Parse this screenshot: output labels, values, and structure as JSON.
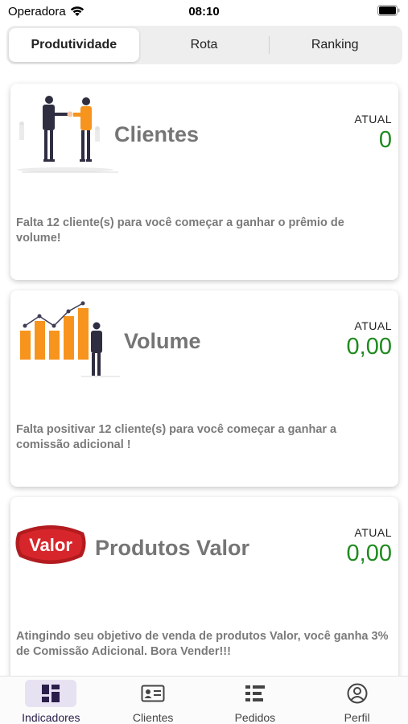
{
  "status_bar": {
    "carrier": "Operadora",
    "time": "08:10"
  },
  "segments": {
    "items": [
      {
        "label": "Produtividade",
        "selected": true
      },
      {
        "label": "Rota",
        "selected": false
      },
      {
        "label": "Ranking",
        "selected": false
      }
    ]
  },
  "cards": [
    {
      "title": "Clientes",
      "atual_label": "ATUAL",
      "atual_value": "0",
      "description": "Falta 12 cliente(s) para você começar a ganhar o prêmio de volume!"
    },
    {
      "title": "Volume",
      "atual_label": "ATUAL",
      "atual_value": "0,00",
      "description": "Falta positivar 12 cliente(s) para você começar a ganhar a comissão adicional !"
    },
    {
      "title": "Produtos Valor",
      "logo_text": "Valor",
      "atual_label": "ATUAL",
      "atual_value": "0,00",
      "description": "Atingindo seu objetivo de venda de produtos Valor, você ganha 3% de Comissão Adicional. Bora Vender!!!"
    }
  ],
  "tabbar": {
    "items": [
      {
        "label": "Indicadores",
        "icon": "dashboard-icon",
        "selected": true
      },
      {
        "label": "Clientes",
        "icon": "contact-card-icon",
        "selected": false
      },
      {
        "label": "Pedidos",
        "icon": "list-icon",
        "selected": false
      },
      {
        "label": "Perfil",
        "icon": "profile-icon",
        "selected": false
      }
    ]
  },
  "colors": {
    "value_green": "#1f8a1f",
    "accent_orange": "#f7941d",
    "brand_red": "#d7262b",
    "tab_active_bg": "#e7e2f2"
  }
}
